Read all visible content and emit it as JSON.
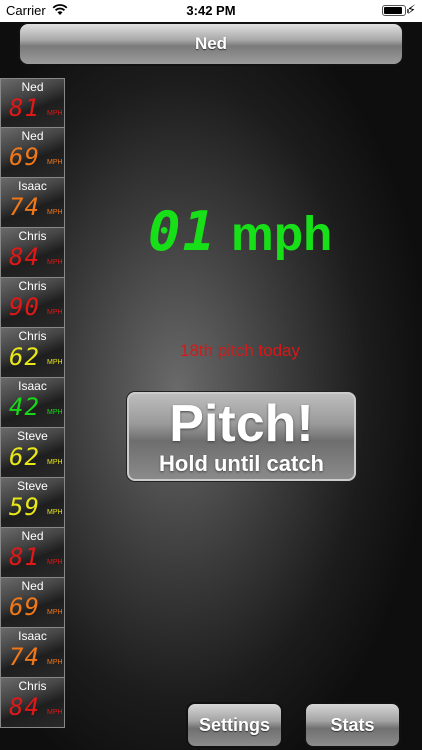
{
  "status_bar": {
    "carrier": "Carrier",
    "time": "3:42 PM",
    "charging_symbol": "⚡"
  },
  "top_button": {
    "label": "Ned"
  },
  "history": [
    {
      "name": "Ned",
      "speed": "81",
      "unit": "MPH",
      "color": "#e01818"
    },
    {
      "name": "Ned",
      "speed": "69",
      "unit": "MPH",
      "color": "#f07818"
    },
    {
      "name": "Isaac",
      "speed": "74",
      "unit": "MPH",
      "color": "#f07818"
    },
    {
      "name": "Chris",
      "speed": "84",
      "unit": "MPH",
      "color": "#e01818"
    },
    {
      "name": "Chris",
      "speed": "90",
      "unit": "MPH",
      "color": "#e01818"
    },
    {
      "name": "Chris",
      "speed": "62",
      "unit": "MPH",
      "color": "#e8e818"
    },
    {
      "name": "Isaac",
      "speed": "42",
      "unit": "MPH",
      "color": "#18d818"
    },
    {
      "name": "Steve",
      "speed": "62",
      "unit": "MPH",
      "color": "#e8e818"
    },
    {
      "name": "Steve",
      "speed": "59",
      "unit": "MPH",
      "color": "#e8e818"
    },
    {
      "name": "Ned",
      "speed": "81",
      "unit": "MPH",
      "color": "#e01818"
    },
    {
      "name": "Ned",
      "speed": "69",
      "unit": "MPH",
      "color": "#f07818"
    },
    {
      "name": "Isaac",
      "speed": "74",
      "unit": "MPH",
      "color": "#f07818"
    },
    {
      "name": "Chris",
      "speed": "84",
      "unit": "MPH",
      "color": "#e01818"
    }
  ],
  "speed_display": {
    "value": "01",
    "unit": "mph",
    "color": "#18e018"
  },
  "pitch_count_text": "18th pitch today",
  "pitch_button": {
    "main_label": "Pitch!",
    "sub_label": "Hold until catch"
  },
  "bottom_buttons": {
    "settings_label": "Settings",
    "stats_label": "Stats"
  }
}
